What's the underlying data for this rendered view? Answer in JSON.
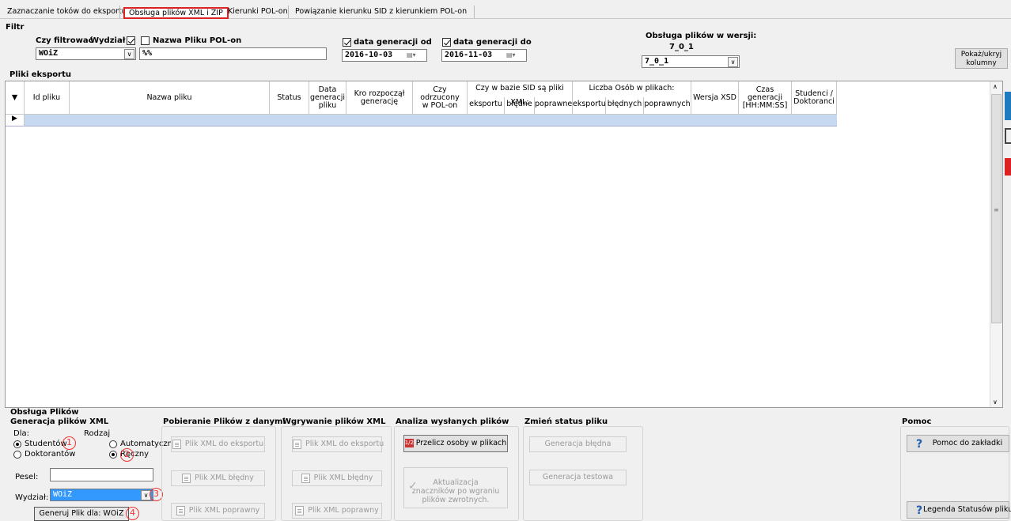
{
  "tabs": [
    {
      "label": "Zaznaczanie toków do eksportu",
      "active": false
    },
    {
      "label": "Obsługa plików XML i ZIP",
      "active": true
    },
    {
      "label": "Kierunki POL-on",
      "active": false
    },
    {
      "label": "Powiązanie kierunku SID z kierunkiem POL-on",
      "active": false
    }
  ],
  "filter": {
    "title": "Filtr",
    "czy_filtrowac_label": "Czy filtrować",
    "wydzial_label": "Wydział",
    "wydzial_checked": true,
    "wydzial_value": "WOiZ",
    "nazwa_pliku_label": "Nazwa Pliku POL-on",
    "nazwa_pliku_checked": false,
    "nazwa_pliku_value": "%%",
    "data_od_label": "data generacji od",
    "data_od_checked": true,
    "data_od_value": "2016-10-03",
    "data_do_label": "data generacji do",
    "data_do_checked": true,
    "data_do_value": "2016-11-03",
    "wersja_label": "Obsługa plików w wersji:",
    "wersja_current": "7_0_1",
    "wersja_select": "7_0_1",
    "pokaz_button": [
      "Pokaż/ukryj",
      "kolumny"
    ]
  },
  "grid": {
    "title": "Pliki eksportu",
    "columns": {
      "id": "Id pliku",
      "nazwa": "Nazwa pliku",
      "status": "Status",
      "data": [
        "Data",
        "generacji",
        "pliku"
      ],
      "kto": [
        "Kro rozpoczął",
        "generację"
      ],
      "odrzucony": [
        "Czy odrzucony",
        "w POL-on"
      ],
      "sid_group": "Czy w bazie SID są pliki XML:",
      "sid_eksportu": "eksportu",
      "sid_bledne": "błędne",
      "sid_poprawne": "poprawne",
      "osob_group": "Liczba Osób w plikach:",
      "osob_eksportu": "eksportu",
      "osob_blednych": "błędnych",
      "osob_poprawnych": "poprawnych",
      "wersja": "Wersja XSD",
      "czas": [
        "Czas generacji",
        "[HH:MM:SS]"
      ],
      "studenci": [
        "Studenci /",
        "Doktoranci"
      ]
    }
  },
  "bottom": {
    "title": "Obsługa Plików",
    "generacja": {
      "title": "Generacja plików XML",
      "dla_label": "Dla:",
      "studentow": "Studentów",
      "doktorantow": "Doktorantów",
      "rodzaj_label": "Rodzaj",
      "automatyczny": "Automatyczny",
      "reczny": "Ręczny",
      "pesel_label": "Pesel:",
      "pesel_value": "",
      "wydzial_label": "Wydział:",
      "wydzial_value": "WOiZ",
      "generuj_button": "Generuj Plik dla: WOiZ"
    },
    "pobieranie": {
      "title": "Pobieranie Plików z danymi",
      "btn1": "Plik XML do eksportu",
      "btn2": "Plik XML błędny",
      "btn3": "Plik XML poprawny"
    },
    "wgrywanie": {
      "title": "Wgrywanie plików XML",
      "btn1": "Plik XML do eksportu",
      "btn2": "Plik XML błędny",
      "btn3": "Plik XML poprawny"
    },
    "analiza": {
      "title": "Analiza wysłanych plików",
      "przelicz": "Przelicz osoby w plikach",
      "aktualizacja": [
        "Aktualizacja",
        "znaczników po wgraniu",
        "plików zwrotnych."
      ]
    },
    "zmien": {
      "title": "Zmień status pliku",
      "btn1": "Generacja błędna",
      "btn2": "Generacja testowa"
    },
    "pomoc": {
      "title": "Pomoc",
      "btn1": "Pomoc do zakładki",
      "btn2": "Legenda Statusów pliku"
    },
    "markers": [
      "1",
      "2",
      "3",
      "4"
    ]
  },
  "colors": {
    "highlight": "#dd2222",
    "selection": "#3399ff",
    "newrow": "#c6d9f0"
  }
}
